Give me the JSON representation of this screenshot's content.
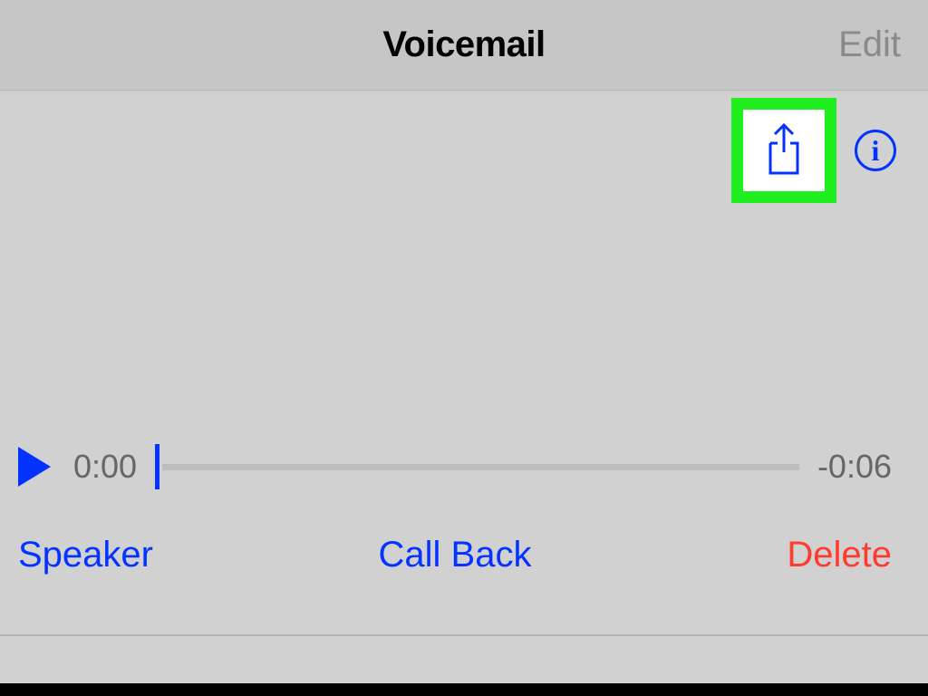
{
  "nav": {
    "title": "Voicemail",
    "edit_label": "Edit"
  },
  "icons": {
    "share": "share-icon",
    "info_glyph": "i"
  },
  "player": {
    "elapsed": "0:00",
    "remaining": "-0:06"
  },
  "actions": {
    "speaker": "Speaker",
    "callback": "Call Back",
    "delete": "Delete"
  },
  "colors": {
    "accent": "#0433ff",
    "destructive": "#ff3b30",
    "highlight": "#1fef1f"
  }
}
